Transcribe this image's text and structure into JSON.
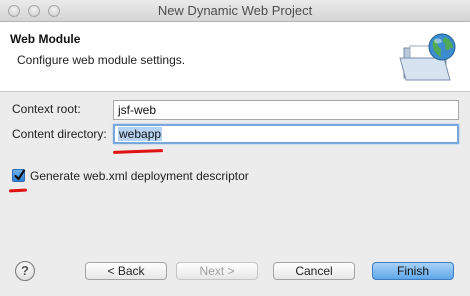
{
  "window": {
    "title": "New Dynamic Web Project"
  },
  "banner": {
    "title": "Web Module",
    "description": "Configure web module settings.",
    "icon": "folder-globe-icon"
  },
  "form": {
    "context_root": {
      "label": "Context root:",
      "value": "jsf-web"
    },
    "content_directory": {
      "label": "Content directory:",
      "value": "webapp"
    },
    "generate_descriptor": {
      "label": "Generate web.xml deployment descriptor",
      "checked": true
    }
  },
  "buttons": {
    "help": "?",
    "back": "< Back",
    "next": "Next >",
    "cancel": "Cancel",
    "finish": "Finish"
  },
  "colors": {
    "annotation": "#e01212",
    "default_button": "#5fa7ea",
    "selection": "#b6d3f4"
  }
}
